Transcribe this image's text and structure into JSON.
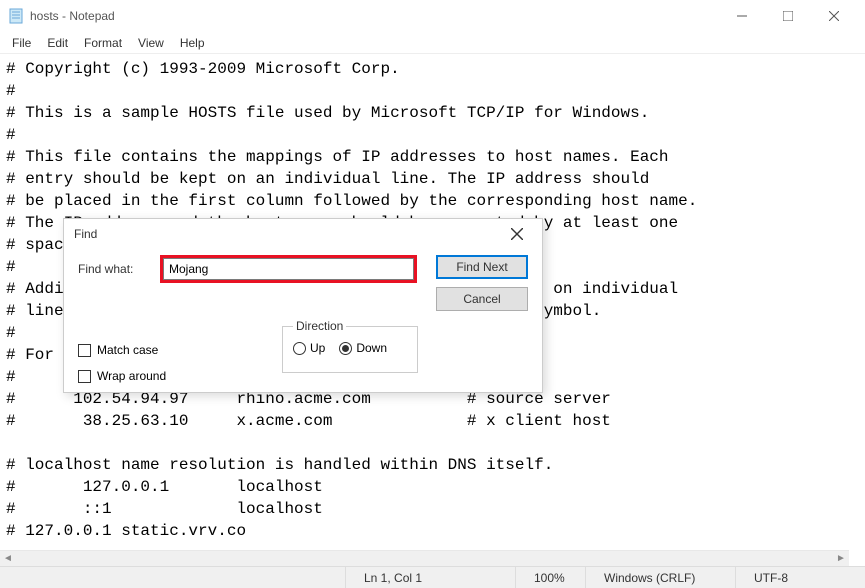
{
  "window": {
    "title": "hosts - Notepad"
  },
  "menu": {
    "file": "File",
    "edit": "Edit",
    "format": "Format",
    "view": "View",
    "help": "Help"
  },
  "editor": {
    "content": "# Copyright (c) 1993-2009 Microsoft Corp.\n#\n# This is a sample HOSTS file used by Microsoft TCP/IP for Windows.\n#\n# This file contains the mappings of IP addresses to host names. Each\n# entry should be kept on an individual line. The IP address should\n# be placed in the first column followed by the corresponding host name.\n# The IP address and the host name should be separated by at least one\n# space.\n#\n# Additionally, comments (such as these) may be inserted on individual\n# lines or following the machine name denoted by a '#' symbol.\n#\n# For example:\n#\n#      102.54.94.97     rhino.acme.com          # source server\n#       38.25.63.10     x.acme.com              # x client host\n\n# localhost name resolution is handled within DNS itself.\n#       127.0.0.1       localhost\n#       ::1             localhost\n# 127.0.0.1 static.vrv.co"
  },
  "find": {
    "title": "Find",
    "label": "Find what:",
    "value": "Mojang",
    "findNext": "Find Next",
    "cancel": "Cancel",
    "direction": "Direction",
    "up": "Up",
    "down": "Down",
    "matchCase": "Match case",
    "wrapAround": "Wrap around"
  },
  "status": {
    "position": "Ln 1, Col 1",
    "zoom": "100%",
    "lineEnding": "Windows (CRLF)",
    "encoding": "UTF-8"
  }
}
